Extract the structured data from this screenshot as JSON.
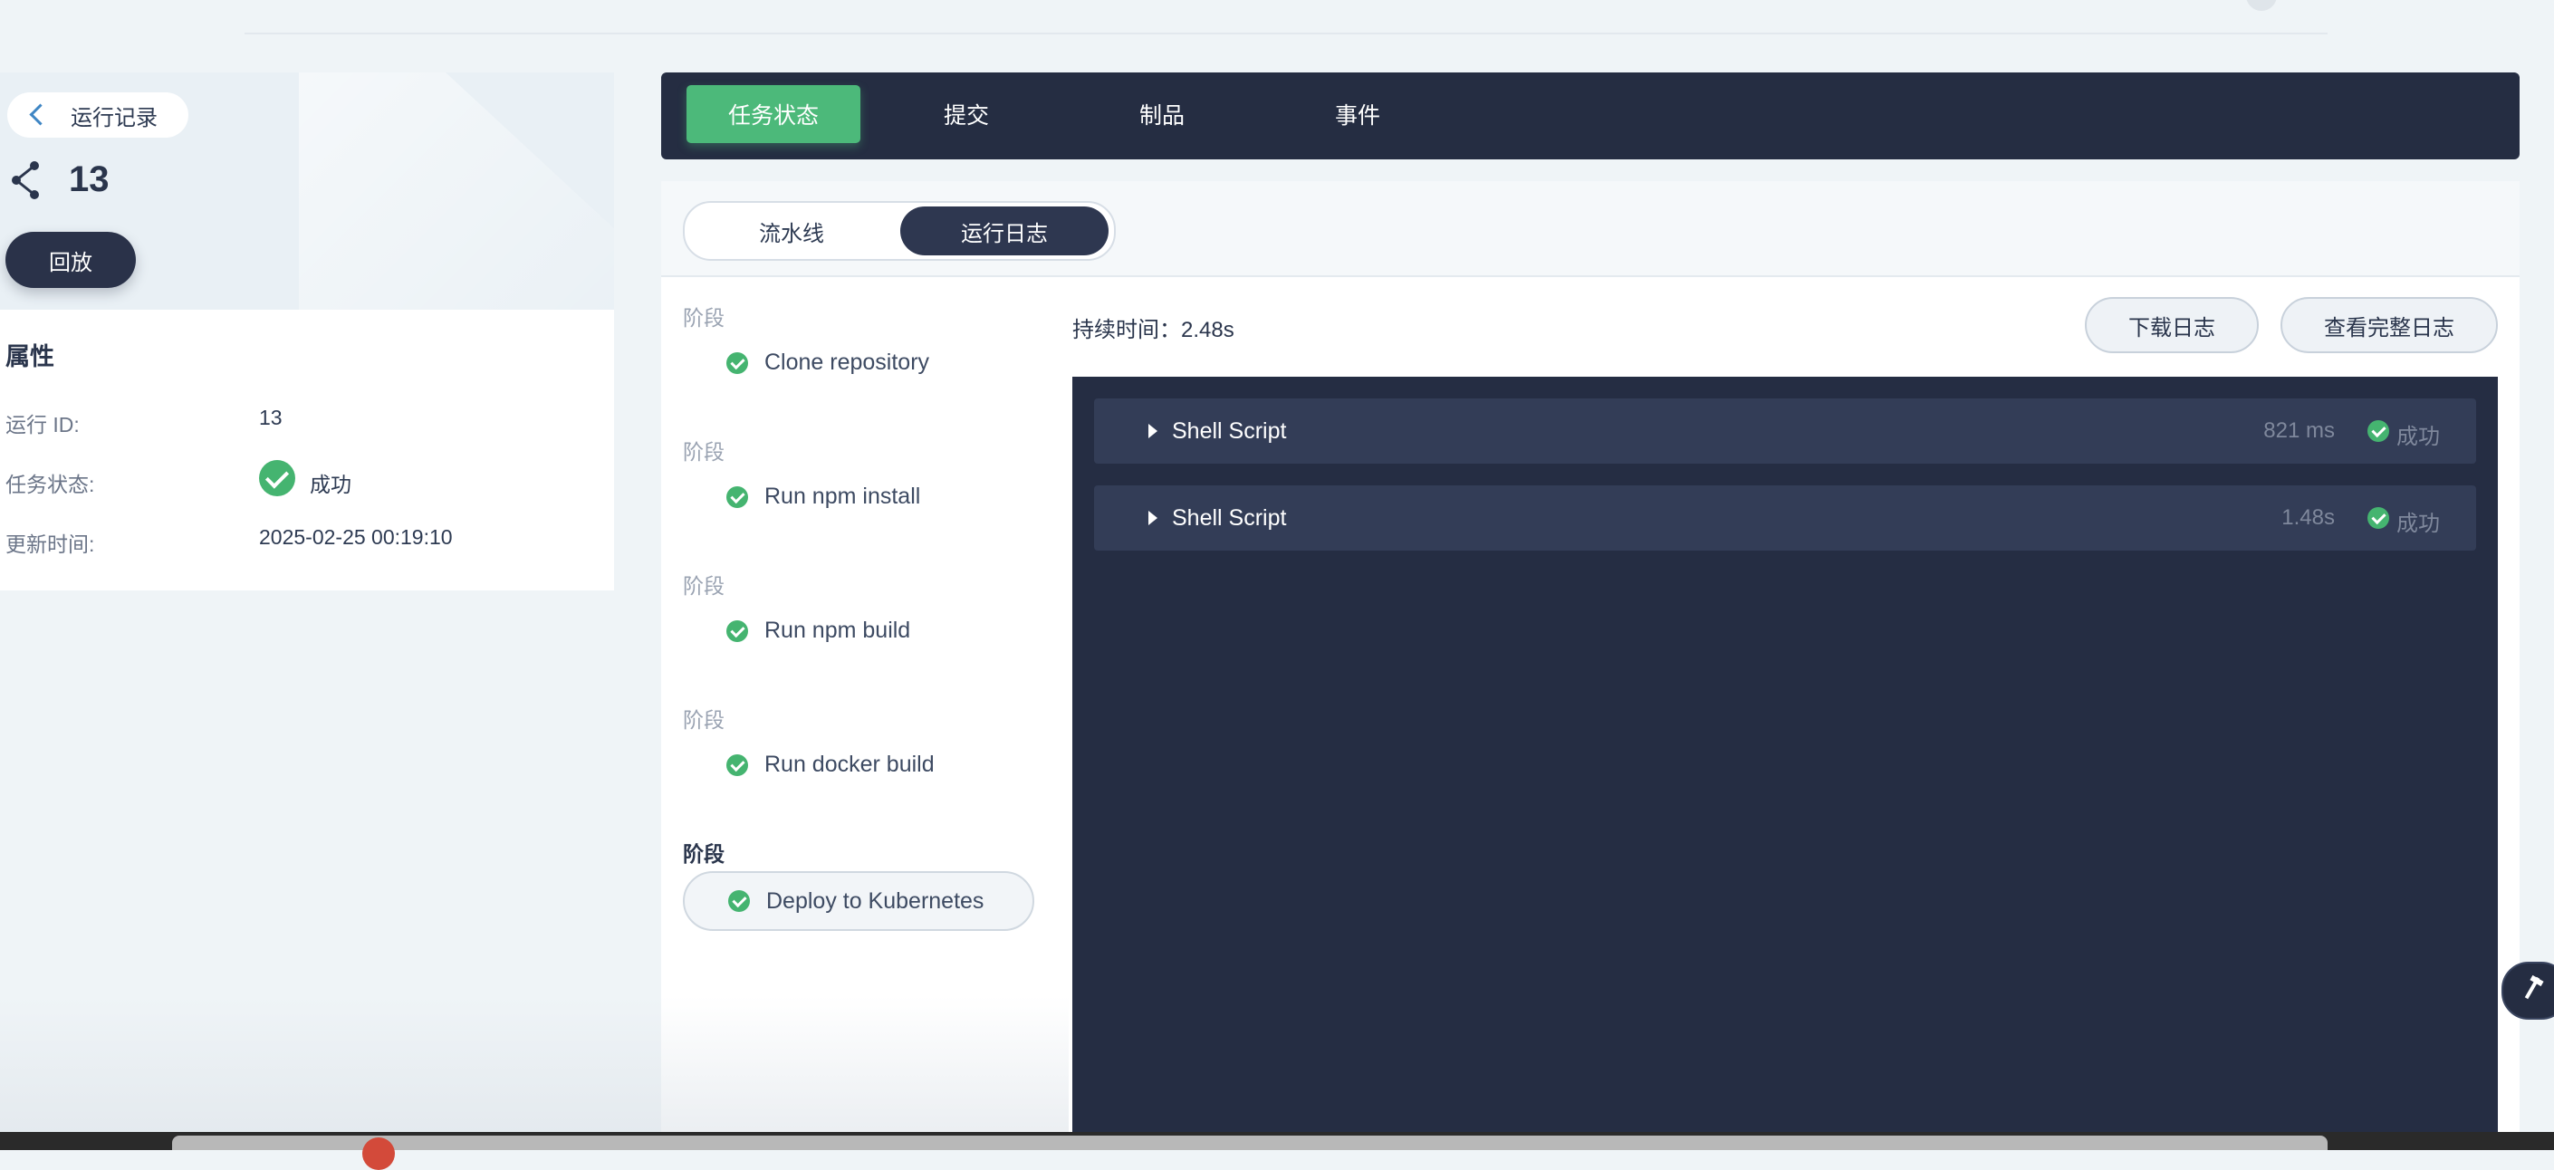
{
  "sidebar": {
    "back_label": "运行记录",
    "run_number": "13",
    "replay_label": "回放",
    "properties": {
      "title": "属性",
      "run_id_label": "运行 ID:",
      "run_id_value": "13",
      "status_label": "任务状态:",
      "status_value": "成功",
      "updated_label": "更新时间:",
      "updated_value": "2025-02-25 00:19:10"
    }
  },
  "tabs": [
    "任务状态",
    "提交",
    "制品",
    "事件"
  ],
  "segment": {
    "pipeline": "流水线",
    "run_log": "运行日志"
  },
  "stages": [
    {
      "label": "阶段",
      "name": "Clone repository"
    },
    {
      "label": "阶段",
      "name": "Run npm install"
    },
    {
      "label": "阶段",
      "name": "Run npm build"
    },
    {
      "label": "阶段",
      "name": "Run docker build"
    },
    {
      "label": "阶段",
      "name": "Deploy to Kubernetes"
    }
  ],
  "log": {
    "duration": "持续时间：2.48s",
    "download_label": "下载日志",
    "full_log_label": "查看完整日志",
    "steps": [
      {
        "name": "Shell Script",
        "time": "821 ms",
        "status": "成功"
      },
      {
        "name": "Shell Script",
        "time": "1.48s",
        "status": "成功"
      }
    ]
  },
  "colors": {
    "nav_bg": "#252d42",
    "accent_green": "#4cb97a",
    "success": "#45b470",
    "log_bg": "#252d43"
  }
}
